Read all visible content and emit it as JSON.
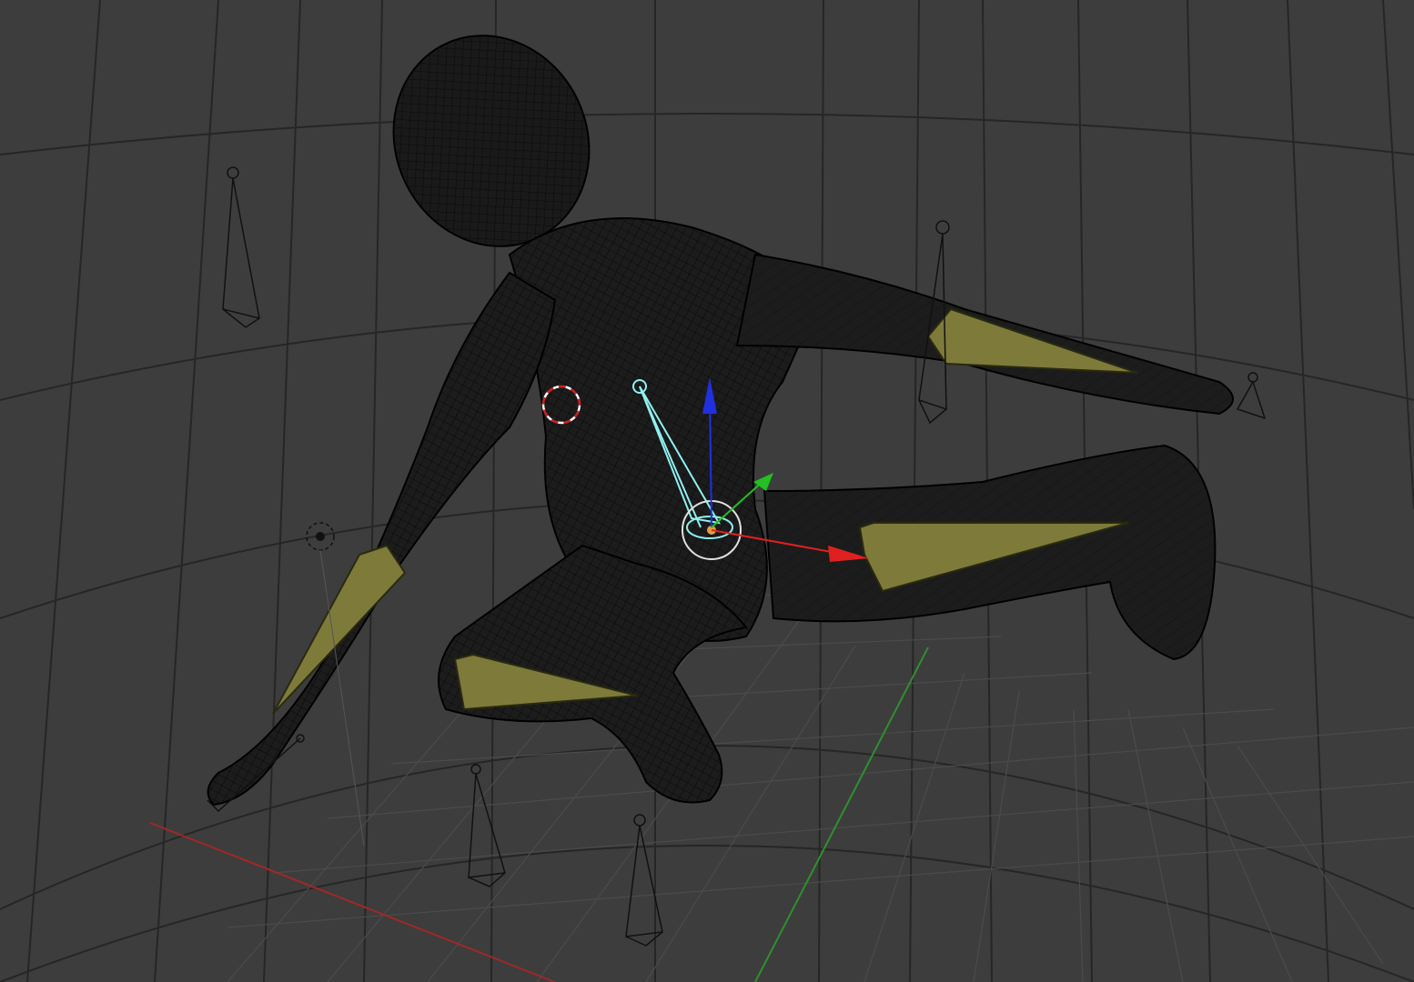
{
  "viewport": {
    "background": "#3d3d3d",
    "grid_color": "#2a2a2a",
    "axis_x_color": "#b03030",
    "axis_y_color": "#3aa03a",
    "mesh_color": "#0a0a0a",
    "bone_fill": "#7e7a3a",
    "bone_stroke": "#2a2a10",
    "selected_bone_color": "#8ff0f0",
    "gizmo_x_color": "#e02020",
    "gizmo_y_color": "#22c022",
    "gizmo_z_color": "#2030e0"
  },
  "objects": [
    {
      "name": "character-mesh",
      "display": "wireframe"
    },
    {
      "name": "armature",
      "display": "octahedral"
    },
    {
      "name": "empty-cameras",
      "count": 6
    },
    {
      "name": "3d-cursor"
    },
    {
      "name": "light"
    }
  ],
  "gizmo": {
    "mode": "translate",
    "axes": [
      "x",
      "y",
      "z"
    ]
  }
}
